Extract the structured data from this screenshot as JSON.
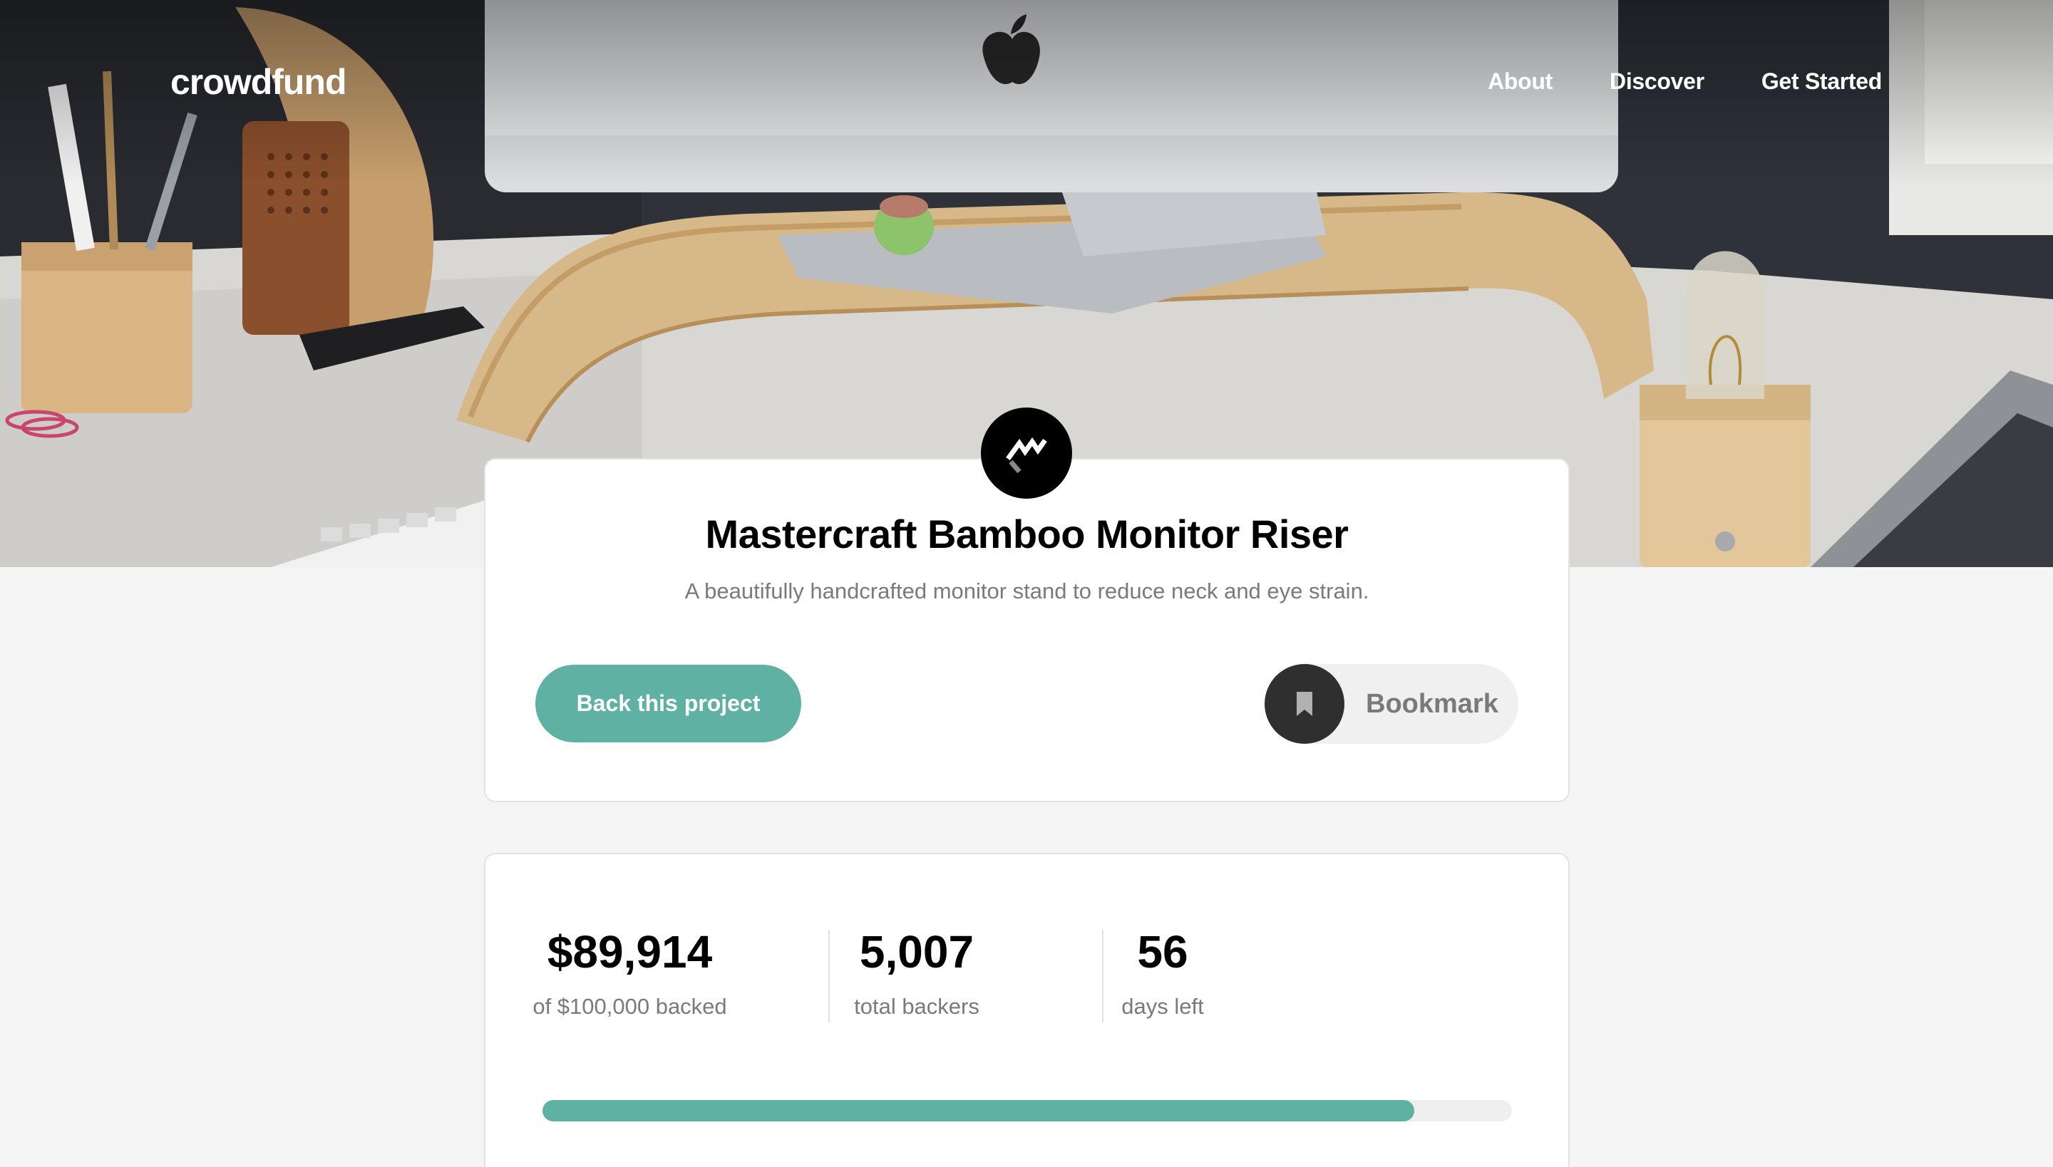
{
  "brand": {
    "name": "crowdfund"
  },
  "nav": {
    "items": [
      {
        "label": "About"
      },
      {
        "label": "Discover"
      },
      {
        "label": "Get Started"
      }
    ]
  },
  "hero": {
    "image": "desk-with-monitor-on-bamboo-riser-photo"
  },
  "project": {
    "logo_icon": "mastercraft-logo-icon",
    "title": "Mastercraft Bamboo Monitor Riser",
    "description": "A beautifully handcrafted monitor stand to reduce neck and eye strain.",
    "back_button_label": "Back this project",
    "bookmark_label": "Bookmark",
    "bookmark_icon": "bookmark-icon"
  },
  "stats": {
    "amount": "$89,914",
    "amount_label": "of $100,000 backed",
    "backers": "5,007",
    "backers_label": "total backers",
    "days": "56",
    "days_label": "days left",
    "progress_fraction": 0.899
  },
  "colors": {
    "accent": "#5fb1a4",
    "text_dark": "#000000",
    "text_muted": "#7a7a7a",
    "background": "#f5f5f5"
  }
}
